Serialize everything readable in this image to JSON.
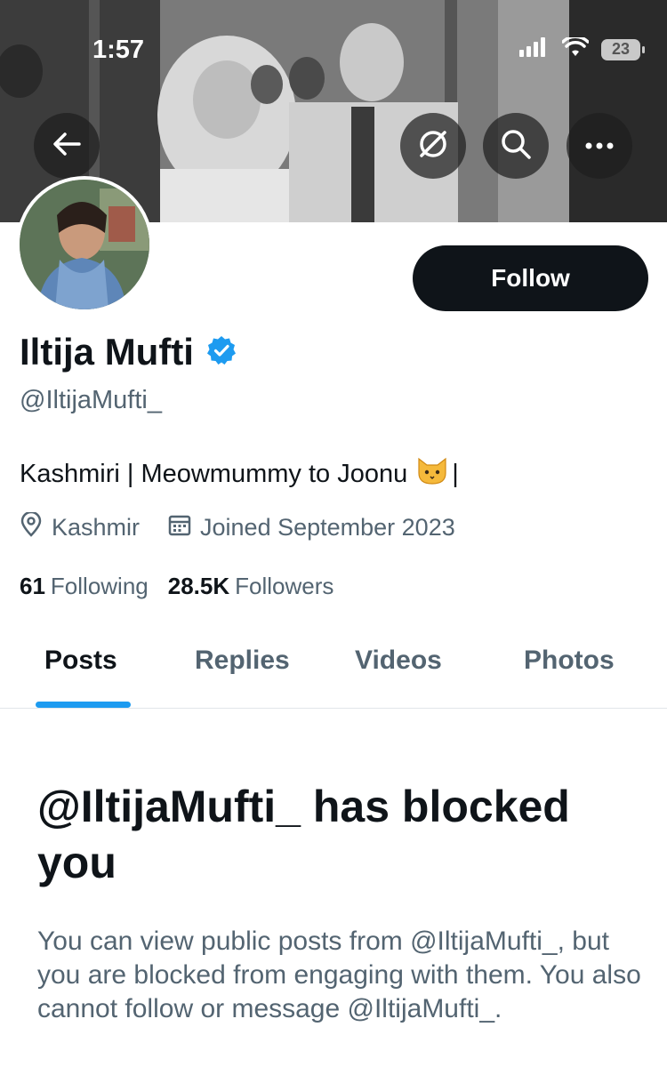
{
  "status_bar": {
    "time": "1:57",
    "battery": "23"
  },
  "header": {
    "back_icon": "arrow-left-icon",
    "grok_icon": "grok-icon",
    "search_icon": "search-icon",
    "more_icon": "more-horizontal-icon"
  },
  "profile": {
    "follow_label": "Follow",
    "display_name": "Iltija Mufti",
    "verified": true,
    "handle": "@IltijaMufti_",
    "bio_text": "Kashmiri | Meowmummy to Joonu",
    "bio_emoji": "cat-face-icon",
    "bio_suffix": "|",
    "location": "Kashmir",
    "joined": "Joined September 2023",
    "following_count": "61",
    "following_label": "Following",
    "followers_count": "28.5K",
    "followers_label": "Followers"
  },
  "tabs": [
    {
      "label": "Posts",
      "active": true
    },
    {
      "label": "Replies",
      "active": false
    },
    {
      "label": "Videos",
      "active": false
    },
    {
      "label": "Photos",
      "active": false
    }
  ],
  "blocked": {
    "title": "@IltijaMufti_ has blocked you",
    "message": "You can view public posts from @IltijaMufti_, but you are blocked from engaging with them. You also cannot follow or message @IltijaMufti_."
  },
  "colors": {
    "accent": "#1d9bf0",
    "text_primary": "#0f1419",
    "text_secondary": "#536471",
    "button_bg": "#0f1419"
  }
}
